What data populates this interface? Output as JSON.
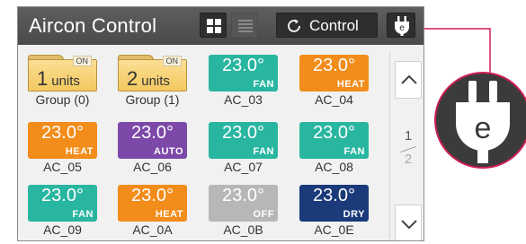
{
  "header": {
    "title": "Aircon Control",
    "control_label": "Control"
  },
  "colors": {
    "fan": "#29b6a0",
    "heat": "#f28c1a",
    "auto": "#7c49a8",
    "off": "#b7b7b7",
    "dry": "#1a3a7a",
    "accent": "#cf1f52"
  },
  "groups": [
    {
      "count": "1",
      "unit_label": "units",
      "status": "ON",
      "label": "Group (0)"
    },
    {
      "count": "2",
      "unit_label": "units",
      "status": "ON",
      "label": "Group (1)"
    }
  ],
  "units": [
    {
      "temp": "23.0°",
      "mode": "FAN",
      "label": "AC_03"
    },
    {
      "temp": "23.0°",
      "mode": "HEAT",
      "label": "AC_04"
    },
    {
      "temp": "23.0°",
      "mode": "HEAT",
      "label": "AC_05"
    },
    {
      "temp": "23.0°",
      "mode": "AUTO",
      "label": "AC_06"
    },
    {
      "temp": "23.0°",
      "mode": "FAN",
      "label": "AC_07"
    },
    {
      "temp": "23.0°",
      "mode": "FAN",
      "label": "AC_08"
    },
    {
      "temp": "23.0°",
      "mode": "FAN",
      "label": "AC_09"
    },
    {
      "temp": "23.0°",
      "mode": "HEAT",
      "label": "AC_0A"
    },
    {
      "temp": "23.0°",
      "mode": "OFF",
      "label": "AC_0B"
    },
    {
      "temp": "23.0°",
      "mode": "DRY",
      "label": "AC_0E"
    }
  ],
  "pager": {
    "current": "1",
    "total": "2"
  },
  "icons": {
    "grid_view": "grid-icon",
    "list_view": "list-icon",
    "control": "refresh-circle-icon",
    "plug": "plug-e-icon",
    "up": "chevron-up-icon",
    "down": "chevron-down-icon"
  },
  "callout": {
    "letter": "e"
  }
}
